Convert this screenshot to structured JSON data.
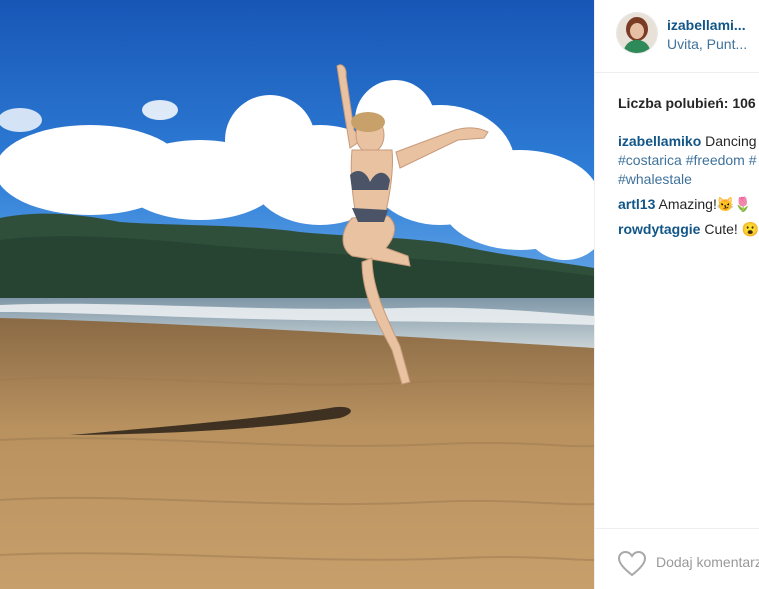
{
  "post": {
    "username": "izabellami...",
    "location": "Uvita, Punt..."
  },
  "likes": {
    "text": "Liczba polubień: 106"
  },
  "caption": {
    "author": "izabellamiko",
    "text_line1": "Dancing",
    "tag_line2": "#costarica #freedom #",
    "tag_line3": "#whalestale"
  },
  "comments": [
    {
      "author": "artl13",
      "text": "Amazing!😼🌷"
    },
    {
      "author": "rowdytaggie",
      "text": "Cute! 😮"
    }
  ],
  "footer": {
    "comment_placeholder": "Dodaj komentarz",
    "like_icon": "heart-outline-icon"
  },
  "colors": {
    "username_blue": "#125688",
    "link_blue": "#3f729b",
    "text": "#262626",
    "muted": "#999999"
  }
}
